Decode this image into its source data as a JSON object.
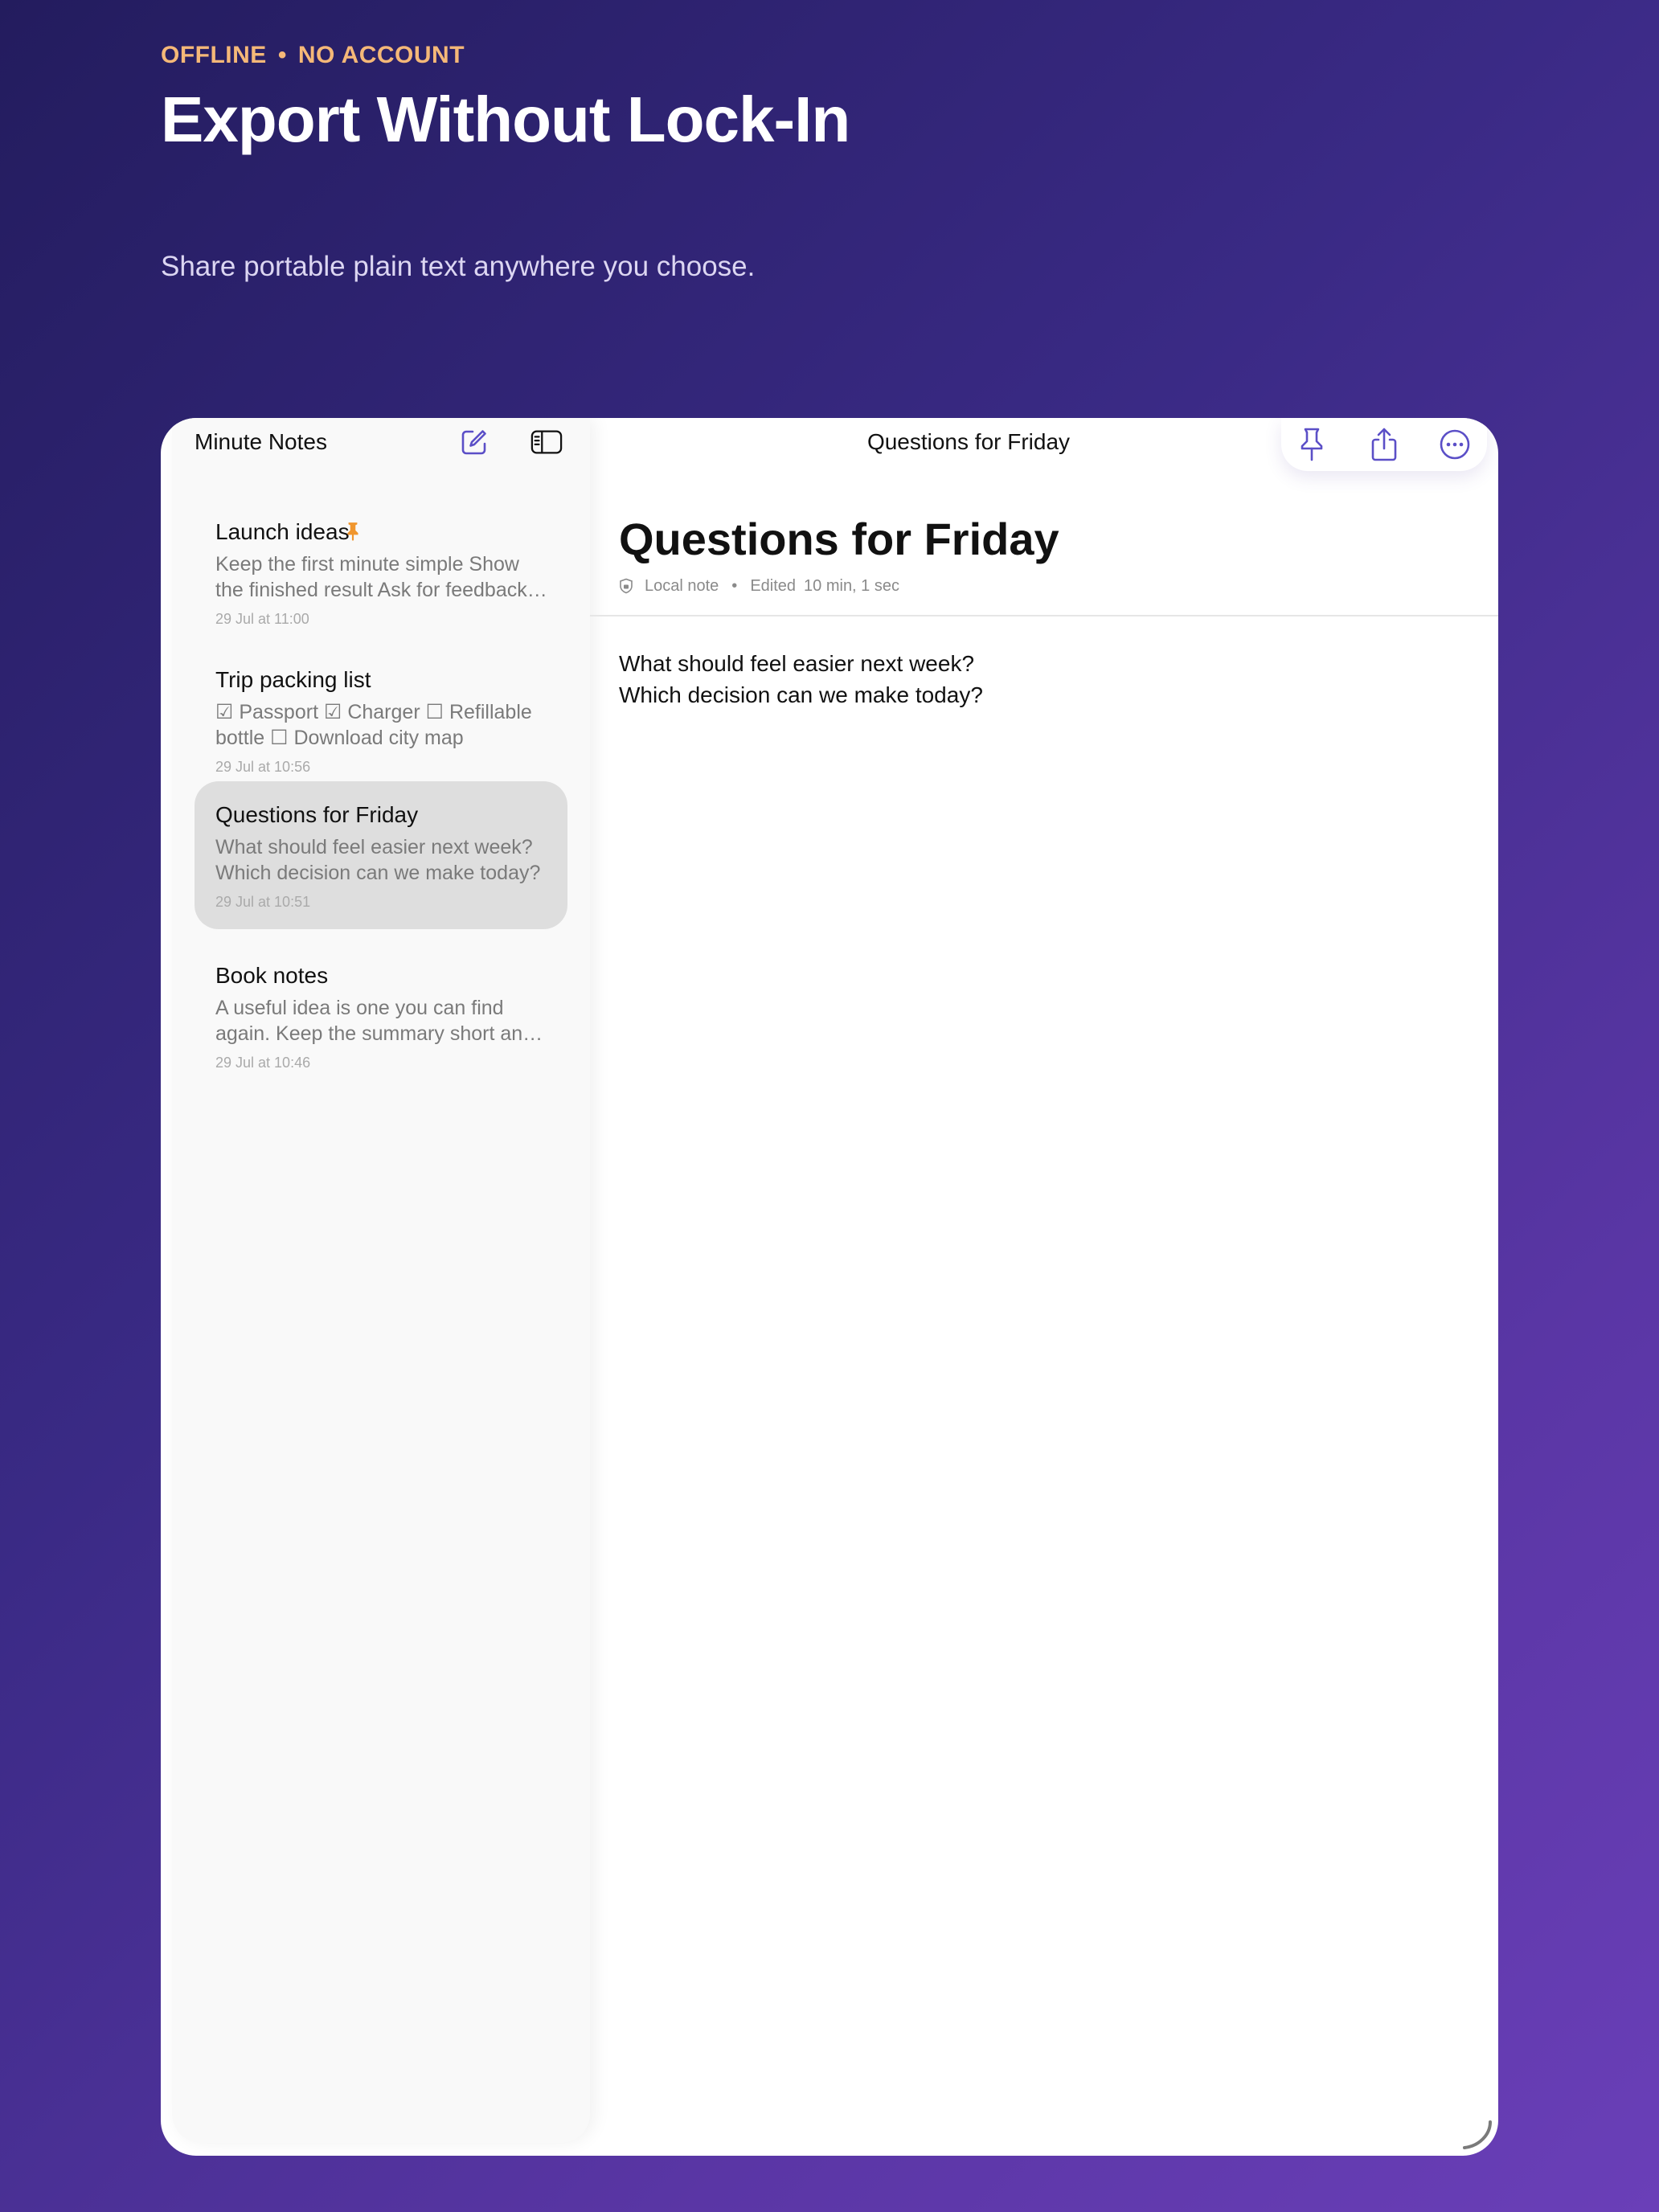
{
  "hero": {
    "eyebrow_left": "OFFLINE",
    "eyebrow_separator": "•",
    "eyebrow_right": "NO ACCOUNT",
    "headline": "Export Without Lock-In",
    "subhead": "Share portable plain text anywhere you choose."
  },
  "sidebar": {
    "title": "Minute Notes",
    "notes": [
      {
        "title": "Launch ideas",
        "pinned": true,
        "preview": "Keep the first minute simple Show the finished result Ask for feedback early",
        "date": "29 Jul at 11:00"
      },
      {
        "title": "Trip packing list",
        "pinned": false,
        "preview": "☑ Passport ☑ Charger ☐ Refillable bottle ☐ Download city map",
        "date": "29 Jul at 10:56"
      },
      {
        "title": "Questions for Friday",
        "pinned": false,
        "preview": "What should feel easier next week? Which decision can we make today?",
        "date": "29 Jul at 10:51",
        "selected": true
      },
      {
        "title": "Book notes",
        "pinned": false,
        "preview": "A useful idea is one you can find again. Keep the summary short and clear",
        "date": "29 Jul at 10:46"
      }
    ]
  },
  "topbar": {
    "title": "Questions for Friday"
  },
  "editor": {
    "title": "Questions for Friday",
    "meta_location": "Local note",
    "meta_separator": "•",
    "meta_edited_label": "Edited",
    "meta_edited_value": "10 min, 1 sec",
    "lines": [
      "What should feel easier next week?",
      "Which decision can we make today?"
    ]
  },
  "colors": {
    "accent": "#5b4fc7",
    "pin": "#f0962e",
    "eyebrow": "#f5b878"
  }
}
